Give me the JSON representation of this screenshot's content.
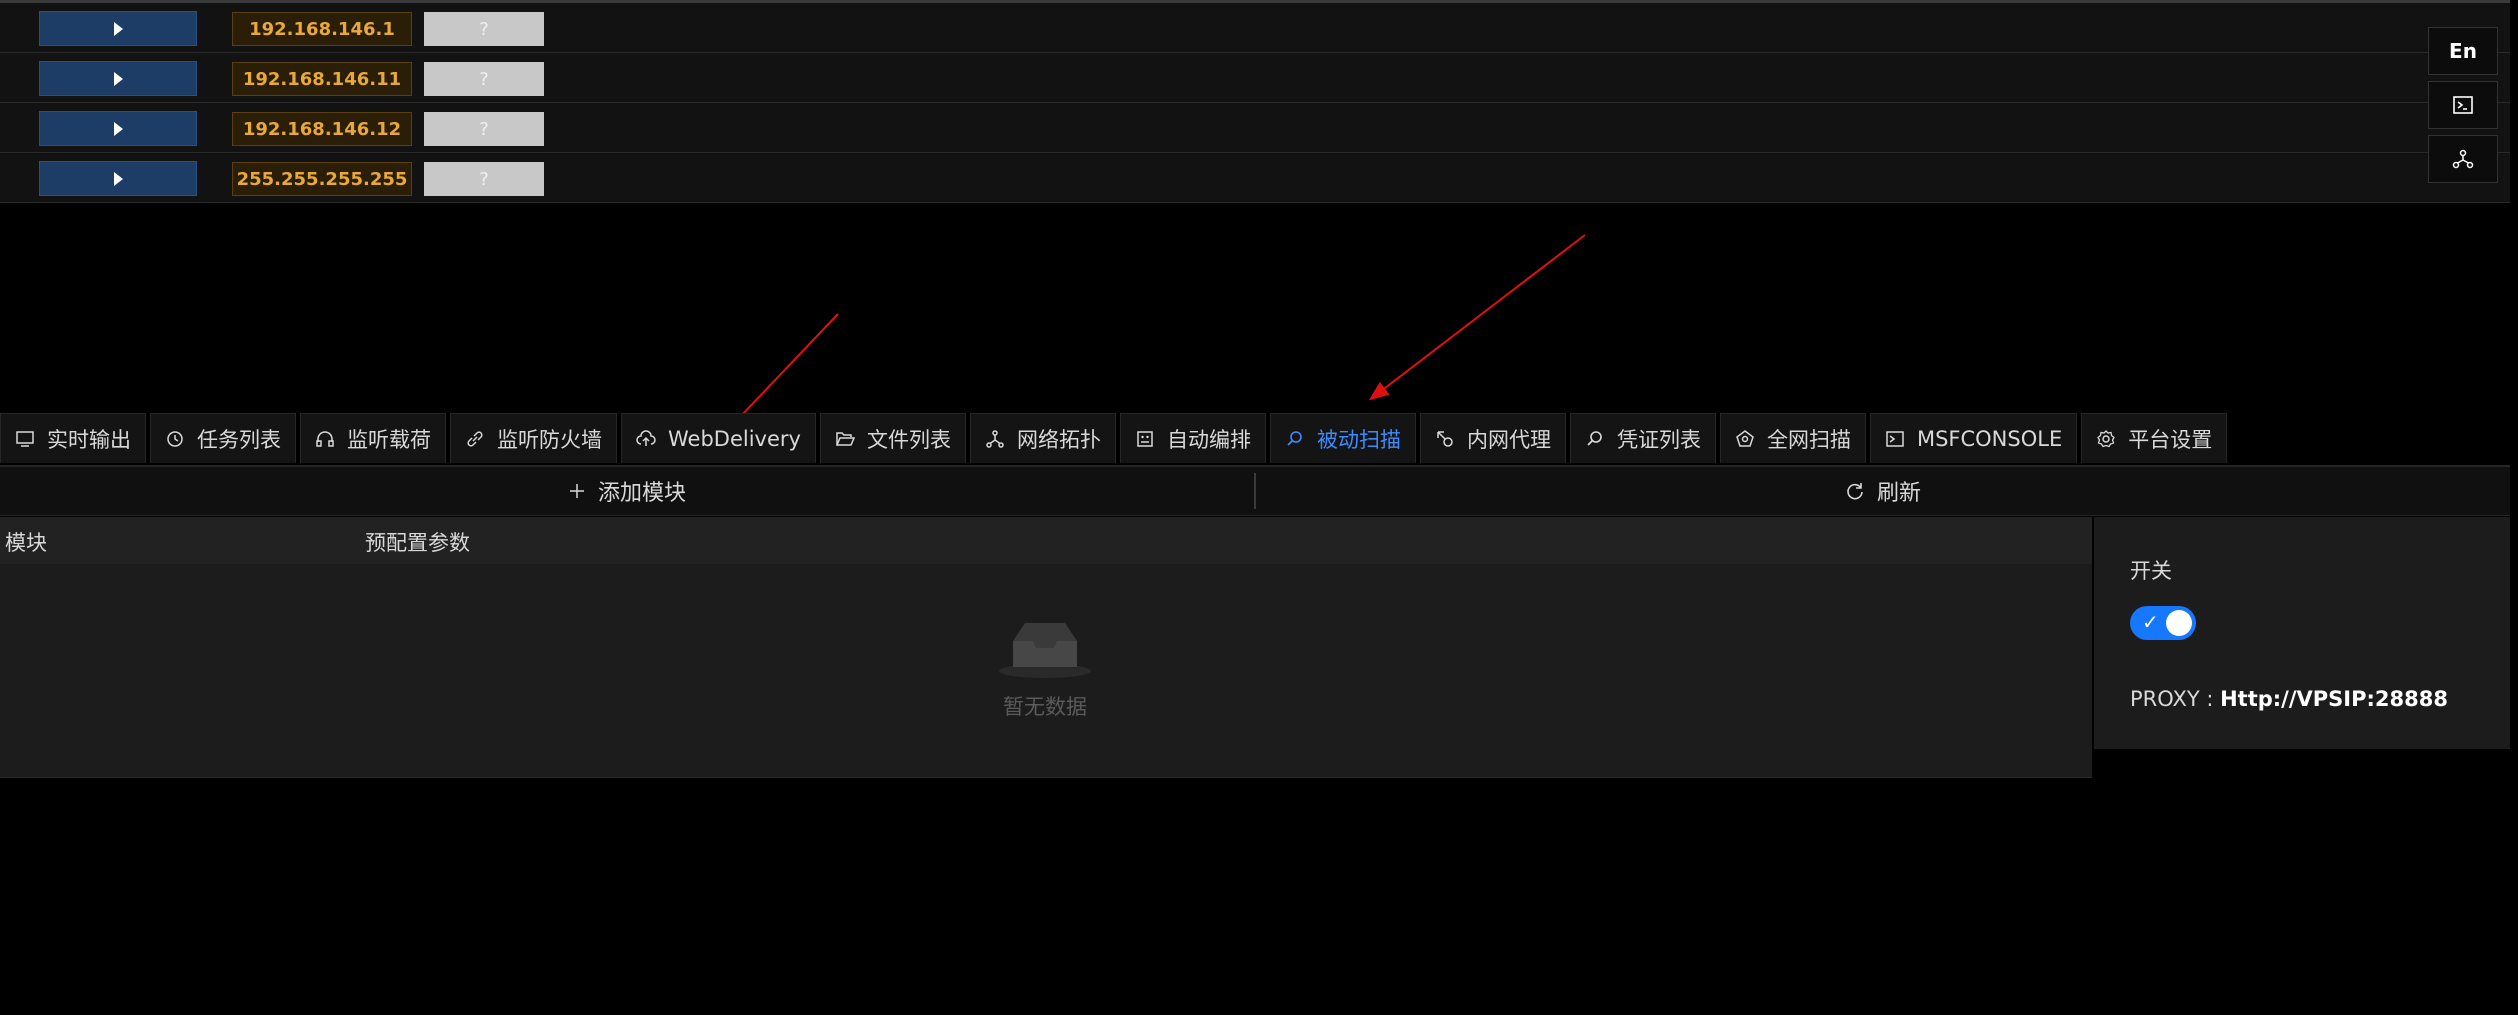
{
  "hosts": [
    {
      "ip": "192.168.146.1",
      "status": "?"
    },
    {
      "ip": "192.168.146.11",
      "status": "?"
    },
    {
      "ip": "192.168.146.12",
      "status": "?"
    },
    {
      "ip": "255.255.255.255",
      "status": "?"
    }
  ],
  "side": {
    "lang_label": "En"
  },
  "tabs": [
    {
      "label": "实时输出",
      "icon": "monitor-icon"
    },
    {
      "label": "任务列表",
      "icon": "clock-icon"
    },
    {
      "label": "监听载荷",
      "icon": "headset-icon"
    },
    {
      "label": "监听防火墙",
      "icon": "link-icon"
    },
    {
      "label": "WebDelivery",
      "icon": "cloud-upload-icon"
    },
    {
      "label": "文件列表",
      "icon": "folder-open-icon"
    },
    {
      "label": "网络拓扑",
      "icon": "topology-icon"
    },
    {
      "label": "自动编排",
      "icon": "robot-icon"
    },
    {
      "label": "被动扫描",
      "icon": "search-icon",
      "active": true
    },
    {
      "label": "内网代理",
      "icon": "proxy-icon"
    },
    {
      "label": "凭证列表",
      "icon": "search-icon"
    },
    {
      "label": "全网扫描",
      "icon": "radar-icon"
    },
    {
      "label": "MSFCONSOLE",
      "icon": "terminal-icon"
    },
    {
      "label": "平台设置",
      "icon": "gear-icon"
    }
  ],
  "actions": {
    "add_module": "添加模块",
    "refresh": "刷新"
  },
  "module_table": {
    "columns": [
      "模块",
      "预配置参数"
    ],
    "empty_text": "暂无数据"
  },
  "panel": {
    "switch_label": "开关",
    "switch_on": true,
    "proxy_prefix": "PROXY : ",
    "proxy_value": "Http://VPSIP:28888"
  },
  "colors": {
    "accent": "#1677ff",
    "ip_text": "#e9a83a",
    "arrow": "#e01010"
  }
}
